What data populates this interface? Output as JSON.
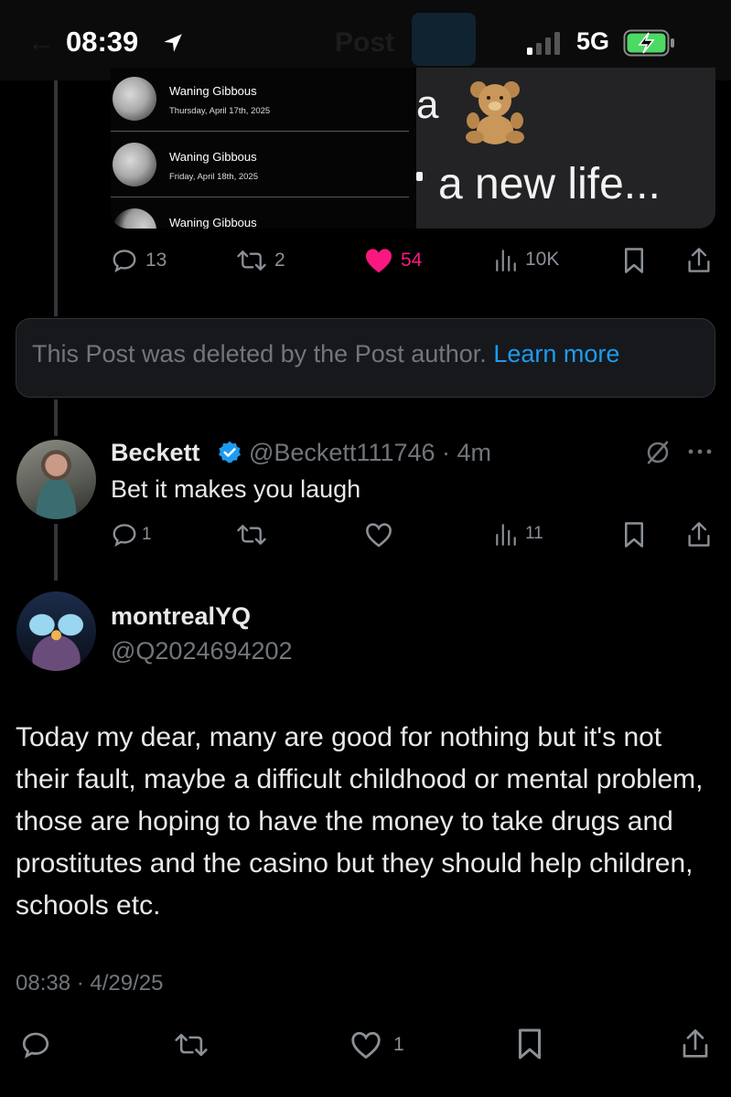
{
  "status_bar": {
    "time": "08:39",
    "network": "5G",
    "ghost_title": "Post",
    "ghost_back": "←"
  },
  "media": {
    "moon_rows": [
      {
        "phase": "Waning Gibbous",
        "date": "Thursday, April 17th, 2025"
      },
      {
        "phase": "Waning Gibbous",
        "date": "Friday, April 18th, 2025"
      },
      {
        "phase": "Waning Gibbous",
        "date": ""
      }
    ],
    "meme_line1": "a",
    "meme_line2": "a new life..."
  },
  "parent_actions": {
    "replies": "13",
    "reposts": "2",
    "likes": "54",
    "views": "10K",
    "like_color": "#f91880"
  },
  "deleted_notice": {
    "text": "This Post was deleted by the Post author.",
    "link": "Learn more"
  },
  "reply": {
    "name": "Beckett",
    "handle": "@Beckett111746 · 4m",
    "text": "Bet it makes you laugh",
    "replies": "1",
    "views": "11"
  },
  "main_post": {
    "name": "montrealYQ",
    "handle": "@Q2024694202",
    "text": "Today my dear, many are good for nothing but it's not their fault, maybe a difficult childhood or mental problem, those are hoping to have the money to take drugs and prostitutes and the casino but they should help children, schools etc.",
    "timestamp": "08:38 · 4/29/25",
    "likes": "1"
  },
  "colors": {
    "accent": "#1d9bf0",
    "muted": "#71767b",
    "text": "#e7e9ea",
    "background": "#000000"
  }
}
